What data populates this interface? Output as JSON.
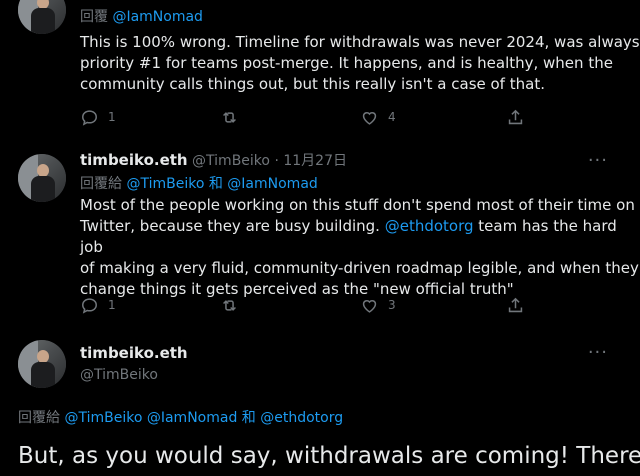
{
  "tweet1": {
    "reply_prefix": "回覆",
    "reply_handle": "@IamNomad",
    "text_lines": [
      "This is 100% wrong. Timeline for withdrawals was never 2024, was always",
      "priority #1 for teams post-merge. It happens, and is healthy, when the",
      "community calls things out, but this really isn't a case of that."
    ],
    "reply_count": "1",
    "retweet_count": "",
    "like_count": "4"
  },
  "tweet2": {
    "name": "timbeiko.eth",
    "handle": "@TimBeiko",
    "dot": "·",
    "date": "11月27日",
    "reply_prefix": "回覆給",
    "reply_handle_1": "@TimBeiko",
    "reply_and": "和",
    "reply_handle_2": "@IamNomad",
    "text_line1": "Most of the people working on this stuff don't spend most of their time on",
    "text_line2_a": "Twitter, because they are busy building. ",
    "text_line2_link": "@ethdotorg",
    "text_line2_b": " team has the hard job",
    "text_line3": "of making a very fluid, community-driven roadmap legible, and when they",
    "text_line4": "change things it gets perceived as the \"new official truth\"",
    "reply_count": "1",
    "retweet_count": "",
    "like_count": "3",
    "more": "···"
  },
  "tweet3": {
    "name": "timbeiko.eth",
    "handle": "@TimBeiko",
    "reply_prefix": "回覆給",
    "reply_handle_1": "@TimBeiko",
    "reply_handle_2": "@IamNomad",
    "reply_and": "和",
    "reply_handle_3": "@ethdotorg",
    "big_text": "But, as you would say, withdrawals are coming! There",
    "more": "···"
  },
  "colors": {
    "background": "#000000",
    "text": "#e7e9ea",
    "muted": "#71767b",
    "link": "#1d9bf0"
  },
  "icons": [
    "reply-icon",
    "retweet-icon",
    "like-icon",
    "share-icon",
    "more-icon"
  ]
}
